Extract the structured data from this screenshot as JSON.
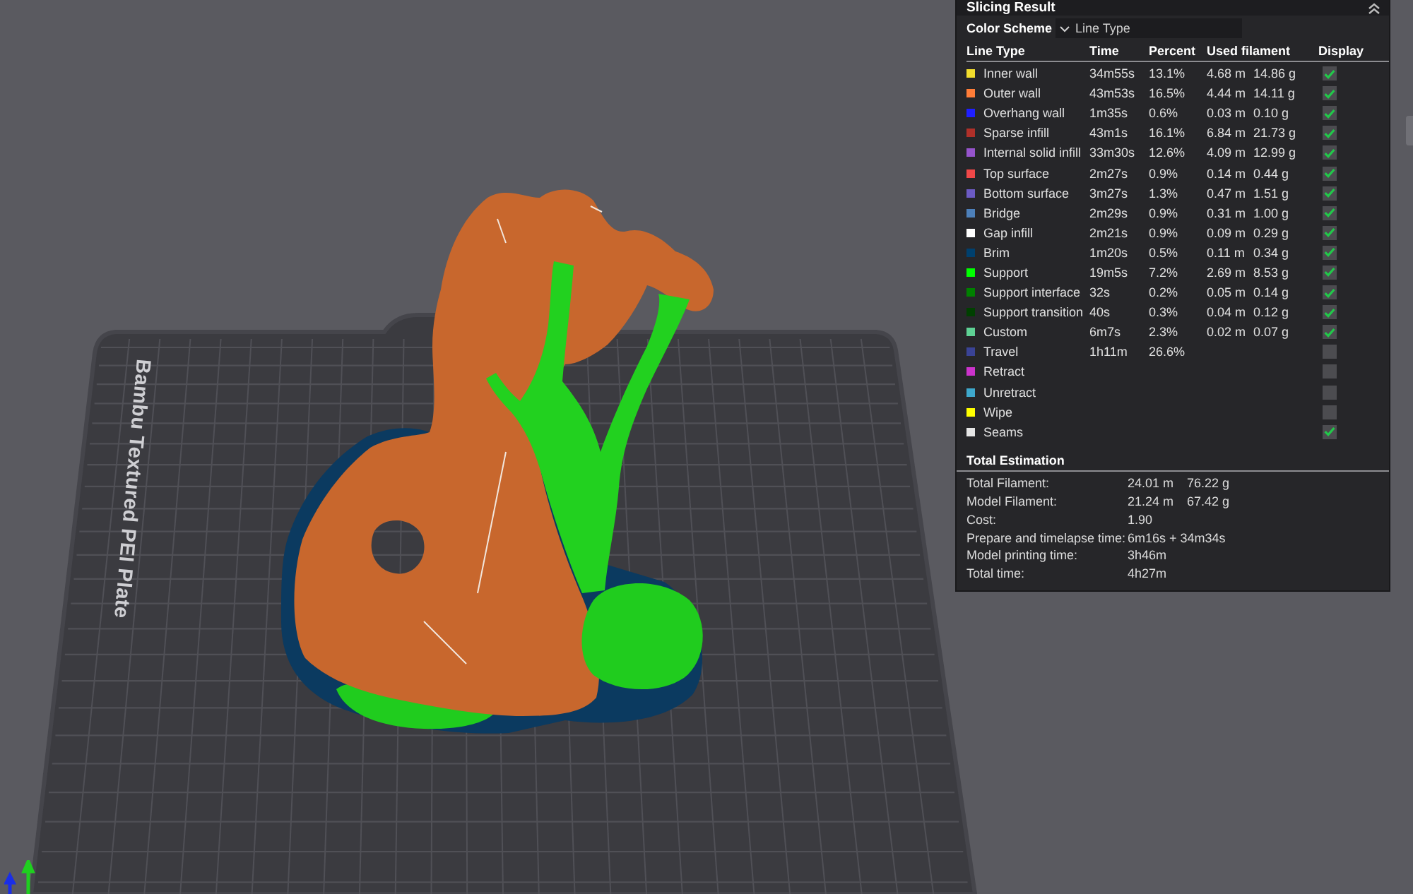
{
  "viewport": {
    "plate_label": "Bambu Textured PEI Plate"
  },
  "panel": {
    "title": "Slicing Result",
    "color_scheme": {
      "label": "Color Scheme",
      "value": "Line Type"
    },
    "columns": [
      "Line Type",
      "Time",
      "Percent",
      "Used filament",
      "Display"
    ],
    "rows": [
      {
        "name": "Inner wall",
        "color": "#f2dd2d",
        "time": "34m55s",
        "percent": "13.1%",
        "length": "4.68 m",
        "weight": "14.86 g",
        "checked": true
      },
      {
        "name": "Outer wall",
        "color": "#ff7d38",
        "time": "43m53s",
        "percent": "16.5%",
        "length": "4.44 m",
        "weight": "14.11 g",
        "checked": true
      },
      {
        "name": "Overhang wall",
        "color": "#1f1fff",
        "time": "1m35s",
        "percent": "0.6%",
        "length": "0.03 m",
        "weight": "0.10 g",
        "checked": true
      },
      {
        "name": "Sparse infill",
        "color": "#b03029",
        "time": "43m1s",
        "percent": "16.1%",
        "length": "6.84 m",
        "weight": "21.73 g",
        "checked": true
      },
      {
        "name": "Internal solid infill",
        "color": "#9654cc",
        "time": "33m30s",
        "percent": "12.6%",
        "length": "4.09 m",
        "weight": "12.99 g",
        "checked": true
      },
      {
        "name": "Top surface",
        "color": "#f04848",
        "time": "2m27s",
        "percent": "0.9%",
        "length": "0.14 m",
        "weight": "0.44 g",
        "checked": true
      },
      {
        "name": "Bottom surface",
        "color": "#6c5bc4",
        "time": "3m27s",
        "percent": "1.3%",
        "length": "0.47 m",
        "weight": "1.51 g",
        "checked": true
      },
      {
        "name": "Bridge",
        "color": "#4d80ba",
        "time": "2m29s",
        "percent": "0.9%",
        "length": "0.31 m",
        "weight": "1.00 g",
        "checked": true
      },
      {
        "name": "Gap infill",
        "color": "#ffffff",
        "time": "2m21s",
        "percent": "0.9%",
        "length": "0.09 m",
        "weight": "0.29 g",
        "checked": true
      },
      {
        "name": "Brim",
        "color": "#00406e",
        "time": "1m20s",
        "percent": "0.5%",
        "length": "0.11 m",
        "weight": "0.34 g",
        "checked": true
      },
      {
        "name": "Support",
        "color": "#00ff00",
        "time": "19m5s",
        "percent": "7.2%",
        "length": "2.69 m",
        "weight": "8.53 g",
        "checked": true
      },
      {
        "name": "Support interface",
        "color": "#008000",
        "time": "32s",
        "percent": "0.2%",
        "length": "0.05 m",
        "weight": "0.14 g",
        "checked": true
      },
      {
        "name": "Support transition",
        "color": "#004000",
        "time": "40s",
        "percent": "0.3%",
        "length": "0.04 m",
        "weight": "0.12 g",
        "checked": true
      },
      {
        "name": "Custom",
        "color": "#5ed194",
        "time": "6m7s",
        "percent": "2.3%",
        "length": "0.02 m",
        "weight": "0.07 g",
        "checked": true
      },
      {
        "name": "Travel",
        "color": "#3a4396",
        "time": "1h11m",
        "percent": "26.6%",
        "checked": false
      },
      {
        "name": "Retract",
        "color": "#cc33cc",
        "checked": false
      },
      {
        "name": "Unretract",
        "color": "#3ea8cc",
        "checked": false
      },
      {
        "name": "Wipe",
        "color": "#ffff00",
        "checked": false
      },
      {
        "name": "Seams",
        "color": "#e6e6e6",
        "checked": true
      }
    ],
    "total_estimation": {
      "title": "Total Estimation",
      "rows": [
        {
          "label": "Total Filament:",
          "values": [
            "24.01 m",
            "76.22 g"
          ]
        },
        {
          "label": "Model Filament:",
          "values": [
            "21.24 m",
            "67.42 g"
          ]
        },
        {
          "label": "Cost:",
          "values": [
            "1.90"
          ]
        },
        {
          "label": "Prepare and timelapse time:",
          "values": [
            "6m16s + 34m34s"
          ]
        },
        {
          "label": "Model printing time:",
          "values": [
            "3h46m"
          ]
        },
        {
          "label": "Total time:",
          "values": [
            "4h27m"
          ]
        }
      ]
    }
  }
}
